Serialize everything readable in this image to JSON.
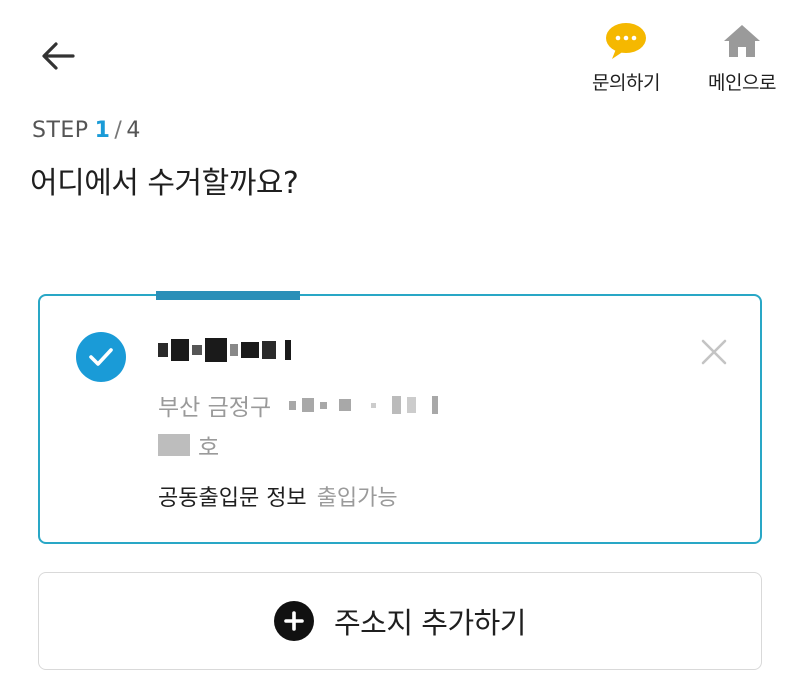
{
  "header": {
    "back_icon": "arrow-left-icon",
    "inquiry": {
      "label": "문의하기",
      "icon": "chat-bubble-icon",
      "color": "#f5b800"
    },
    "home": {
      "label": "메인으로",
      "icon": "home-icon",
      "color": "#9a9a9a"
    }
  },
  "step": {
    "prefix": "STEP",
    "current": "1",
    "separator": "/",
    "total": "4"
  },
  "question": "어디에서 수거할까요?",
  "address_card": {
    "selected": true,
    "address_line1": "부산 금정구",
    "address_line2_suffix": "호",
    "entry_label": "공동출입문 정보",
    "entry_value": "출입가능",
    "accent": "#1a9bd7",
    "border": "#29a7c6"
  },
  "add_address": {
    "label": "주소지 추가하기",
    "icon": "plus-circle-icon"
  }
}
